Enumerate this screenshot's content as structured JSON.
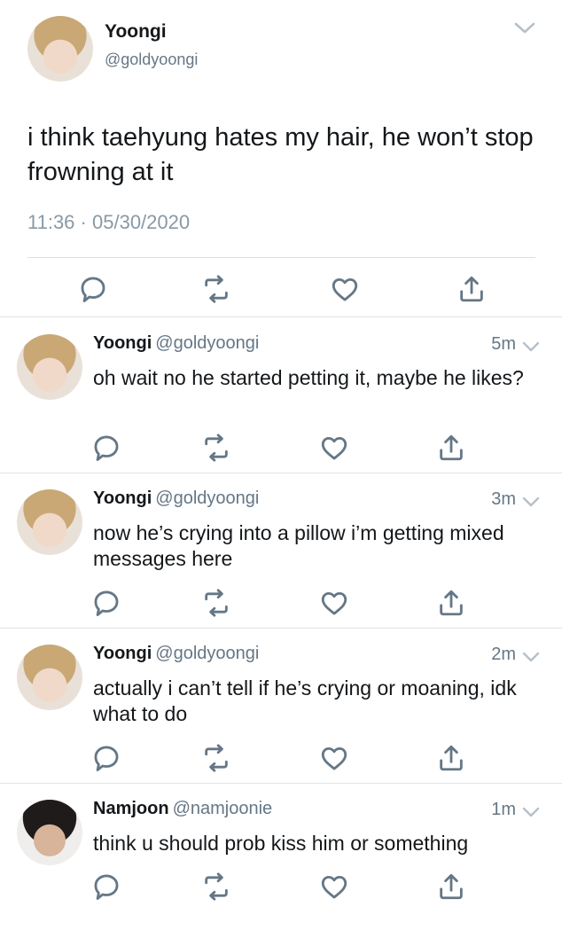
{
  "main_tweet": {
    "name": "Yoongi",
    "handle": "@goldyoongi",
    "text": "i think taehyung hates my hair, he won’t stop frowning at it",
    "time": "11:36",
    "date_sep": "·",
    "date": "05/30/2020"
  },
  "replies": [
    {
      "name": "Yoongi",
      "handle": "@goldyoongi",
      "time": "5m",
      "text": "oh wait no he started petting it, maybe he likes?"
    },
    {
      "name": "Yoongi",
      "handle": "@goldyoongi",
      "time": "3m",
      "text": "now he’s crying into a pillow i’m getting mixed messages here"
    },
    {
      "name": "Yoongi",
      "handle": "@goldyoongi",
      "time": "2m",
      "text": "actually i can’t tell if he’s crying or moaning, idk what to do"
    },
    {
      "name": "Namjoon",
      "handle": "@namjoonie",
      "time": "1m",
      "text": "think u should prob kiss him or something"
    }
  ],
  "icons": {
    "reply": "reply-icon",
    "retweet": "retweet-icon",
    "like": "like-icon",
    "share": "share-icon",
    "chevron": "chevron-down-icon"
  },
  "colors": {
    "text": "#14171a",
    "secondary": "#657786",
    "icon": "#657786",
    "divider": "#dfe3e7"
  }
}
